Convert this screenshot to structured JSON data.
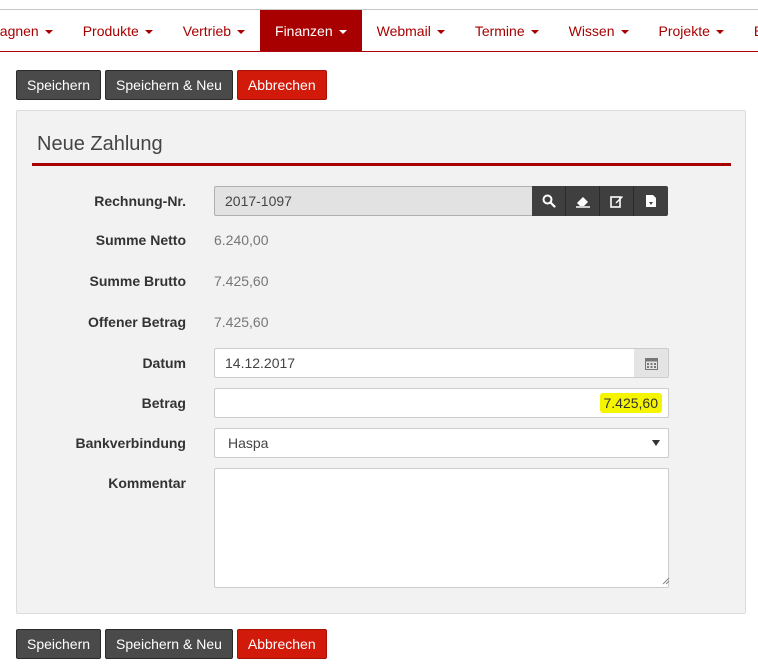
{
  "nav": {
    "items": [
      {
        "label": "pagnen",
        "active": false
      },
      {
        "label": "Produkte",
        "active": false
      },
      {
        "label": "Vertrieb",
        "active": false
      },
      {
        "label": "Finanzen",
        "active": true
      },
      {
        "label": "Webmail",
        "active": false
      },
      {
        "label": "Termine",
        "active": false
      },
      {
        "label": "Wissen",
        "active": false
      },
      {
        "label": "Projekte",
        "active": false
      },
      {
        "label": "Be",
        "active": false
      }
    ]
  },
  "toolbar": {
    "save_label": "Speichern",
    "save_new_label": "Speichern & Neu",
    "cancel_label": "Abbrechen"
  },
  "form": {
    "title": "Neue Zahlung",
    "invoice_label": "Rechnung-Nr.",
    "invoice_value": "2017-1097",
    "net_label": "Summe Netto",
    "net_value": "6.240,00",
    "gross_label": "Summe Brutto",
    "gross_value": "7.425,60",
    "open_label": "Offener Betrag",
    "open_value": "7.425,60",
    "date_label": "Datum",
    "date_value": "14.12.2017",
    "amount_label": "Betrag",
    "amount_value": "7.425,60",
    "bank_label": "Bankverbindung",
    "bank_value": "Haspa",
    "comment_label": "Kommentar",
    "comment_value": ""
  },
  "colors": {
    "brand": "#a80000",
    "cancel": "#d11a0a",
    "highlight": "#f5f500"
  },
  "icons": [
    "search-icon",
    "eraser-icon",
    "edit-icon",
    "pdf-download-icon",
    "calendar-icon",
    "chevron-down-icon"
  ]
}
